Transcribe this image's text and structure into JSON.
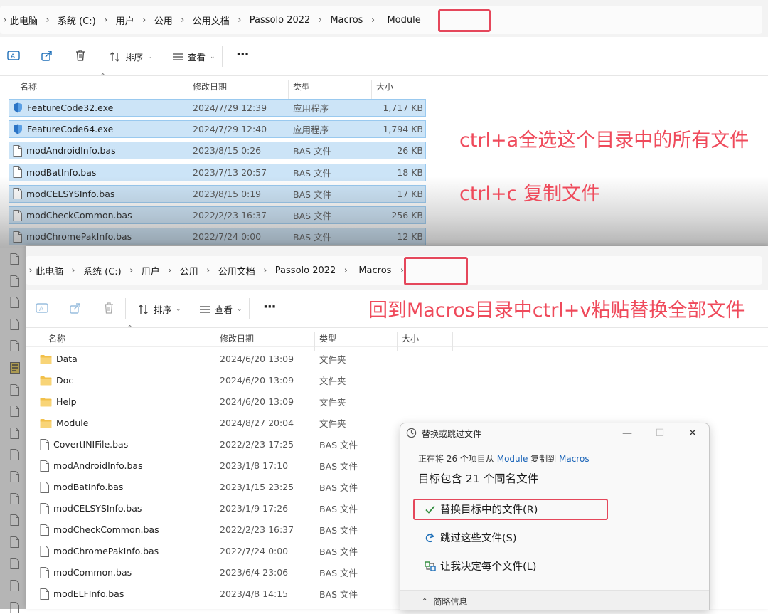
{
  "top_window": {
    "breadcrumbs": [
      "此电脑",
      "系统 (C:)",
      "用户",
      "公用",
      "公用文档",
      "Passolo 2022",
      "Macros",
      "Module"
    ],
    "toolbar": {
      "sort_label": "排序",
      "view_label": "查看",
      "more_label": "···"
    },
    "columns": {
      "name": "名称",
      "date": "修改日期",
      "type": "类型",
      "size": "大小"
    },
    "files": [
      {
        "name": "FeatureCode32.exe",
        "date": "2024/7/29 12:39",
        "type": "应用程序",
        "size": "1,717 KB",
        "icon": "exe-icon"
      },
      {
        "name": "FeatureCode64.exe",
        "date": "2024/7/29 12:40",
        "type": "应用程序",
        "size": "1,794 KB",
        "icon": "exe-icon"
      },
      {
        "name": "modAndroidInfo.bas",
        "date": "2023/8/15 0:26",
        "type": "BAS 文件",
        "size": "26 KB",
        "icon": "file-icon"
      },
      {
        "name": "modBatInfo.bas",
        "date": "2023/7/13 20:57",
        "type": "BAS 文件",
        "size": "18 KB",
        "icon": "file-icon"
      },
      {
        "name": "modCELSYSInfo.bas",
        "date": "2023/8/15 0:19",
        "type": "BAS 文件",
        "size": "17 KB",
        "icon": "file-icon"
      },
      {
        "name": "modCheckCommon.bas",
        "date": "2022/2/23 16:37",
        "type": "BAS 文件",
        "size": "256 KB",
        "icon": "file-icon"
      },
      {
        "name": "modChromePakInfo.bas",
        "date": "2022/7/24 0:00",
        "type": "BAS 文件",
        "size": "12 KB",
        "icon": "file-icon"
      }
    ]
  },
  "annotations": {
    "select_all": "ctrl+a全选这个目录中的所有文件",
    "copy": "ctrl+c 复制文件",
    "paste": "回到Macros目录中ctrl+v粘贴替换全部文件"
  },
  "bottom_window": {
    "breadcrumbs": [
      "此电脑",
      "系统 (C:)",
      "用户",
      "公用",
      "公用文档",
      "Passolo 2022",
      "Macros"
    ],
    "toolbar": {
      "sort_label": "排序",
      "view_label": "查看",
      "more_label": "···"
    },
    "columns": {
      "name": "名称",
      "date": "修改日期",
      "type": "类型",
      "size": "大小"
    },
    "files": [
      {
        "name": "Data",
        "date": "2024/6/20 13:09",
        "type": "文件夹",
        "icon": "folder-icon"
      },
      {
        "name": "Doc",
        "date": "2024/6/20 13:09",
        "type": "文件夹",
        "icon": "folder-icon"
      },
      {
        "name": "Help",
        "date": "2024/6/20 13:09",
        "type": "文件夹",
        "icon": "folder-icon"
      },
      {
        "name": "Module",
        "date": "2024/8/27 20:04",
        "type": "文件夹",
        "icon": "folder-icon"
      },
      {
        "name": "CovertINIFile.bas",
        "date": "2022/2/23 17:25",
        "type": "BAS 文件",
        "icon": "file-icon"
      },
      {
        "name": "modAndroidInfo.bas",
        "date": "2023/1/8 17:10",
        "type": "BAS 文件",
        "icon": "file-icon"
      },
      {
        "name": "modBatInfo.bas",
        "date": "2023/1/15 23:25",
        "type": "BAS 文件",
        "icon": "file-icon"
      },
      {
        "name": "modCELSYSInfo.bas",
        "date": "2023/1/9 17:26",
        "type": "BAS 文件",
        "icon": "file-icon"
      },
      {
        "name": "modCheckCommon.bas",
        "date": "2022/2/23 16:37",
        "type": "BAS 文件",
        "icon": "file-icon"
      },
      {
        "name": "modChromePakInfo.bas",
        "date": "2022/7/24 0:00",
        "type": "BAS 文件",
        "icon": "file-icon"
      },
      {
        "name": "modCommon.bas",
        "date": "2023/6/4 23:06",
        "type": "BAS 文件",
        "icon": "file-icon"
      },
      {
        "name": "modELFInfo.bas",
        "date": "2023/4/8 14:15",
        "type": "BAS 文件",
        "icon": "file-icon"
      }
    ]
  },
  "dialog": {
    "title": "替换或跳过文件",
    "progress_prefix": "正在将 26 个项目从 ",
    "source": "Module",
    "progress_mid": " 复制到 ",
    "target": "Macros",
    "conflict_text": "目标包含 21 个同名文件",
    "replace_label": "替换目标中的文件(R)",
    "skip_label": "跳过这些文件(S)",
    "decide_label": "让我决定每个文件(L)",
    "details_label": "简略信息"
  },
  "colors": {
    "annotation": "#ef4a5b",
    "highlight_border": "#e5475b",
    "selection": "#cce4f7",
    "link": "#1a64b8",
    "check": "#2e8b3a"
  }
}
